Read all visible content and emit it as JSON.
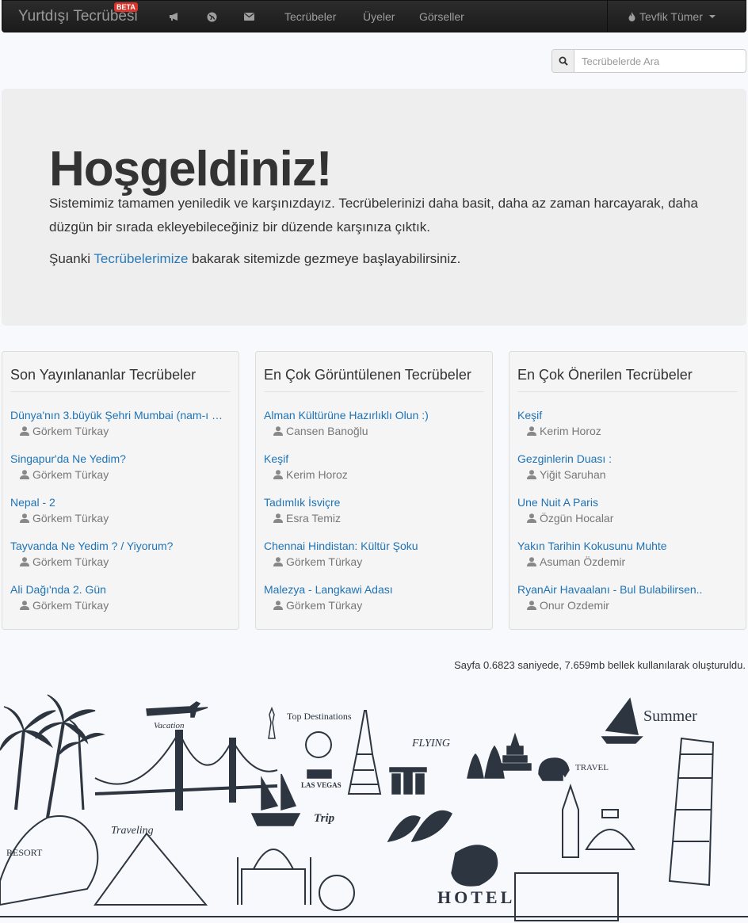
{
  "navbar": {
    "brand": "Yurtdışı Tecrübesi",
    "badge": "BETA",
    "icons": [
      "megaphone-icon",
      "globe-icon",
      "envelope-icon"
    ],
    "links": [
      "Tecrübeler",
      "Üyeler",
      "Görseller"
    ],
    "user": "Tevfik Tümer"
  },
  "search": {
    "placeholder": "Tecrübelerde Ara"
  },
  "hero": {
    "title": "Hoşgeldiniz!",
    "lead": "Sistemimiz tamamen yeniledik ve karşınızdayız. Tecrübelerinizi daha basit, daha az zaman harcayarak, daha düzgün bir sırada ekleyebileceğiniz bir düzende karşınıza çıktık.",
    "lead2_pre": "Şuanki ",
    "lead2_link": "Tecrübelerimize",
    "lead2_post": " bakarak sitemizde gezmeye başlayabilirsiniz."
  },
  "panels": [
    {
      "title": "Son Yayınlananlar Tecrübeler",
      "items": [
        {
          "title": "Dünya'nın 3.büyük Şehri Mumbai (nam-ı …",
          "author": "Görkem Türkay"
        },
        {
          "title": "Singapur'da Ne Yedim?",
          "author": "Görkem Türkay"
        },
        {
          "title": "Nepal - 2",
          "author": "Görkem Türkay"
        },
        {
          "title": "Tayvanda Ne Yedim ? / Yiyorum?",
          "author": "Görkem Türkay"
        },
        {
          "title": "Ali Dağı'nda 2. Gün",
          "author": "Görkem Türkay"
        }
      ]
    },
    {
      "title": "En Çok Görüntülenen Tecrübeler",
      "items": [
        {
          "title": "Alman Kültürüne Hazırlıklı Olun :)",
          "author": "Cansen Banoğlu"
        },
        {
          "title": "Keşif",
          "author": "Kerim Horoz"
        },
        {
          "title": "Tadımlık İsviçre",
          "author": "Esra Temiz"
        },
        {
          "title": "Chennai Hindistan: Kültür Şoku",
          "author": "Görkem Türkay"
        },
        {
          "title": "Malezya - Langkawi Adası",
          "author": "Görkem Türkay"
        }
      ]
    },
    {
      "title": "En Çok Önerilen Tecrübeler",
      "items": [
        {
          "title": "Keşif",
          "author": "Kerim Horoz"
        },
        {
          "title": "Gezginlerin Duası :",
          "author": "Yiğit Saruhan"
        },
        {
          "title": "Une Nuit A Paris",
          "author": "Özgün Hocalar"
        },
        {
          "title": "Yakın Tarihin Kokusunu Muhte",
          "author": "Asuman Özdemir"
        },
        {
          "title": "RyanAir Havaalanı - Bul Bulabilirsen..",
          "author": "Onur Ozdemir"
        }
      ]
    }
  ],
  "footer": "Sayfa 0.6823 saniyede, 7.659mb bellek kullanılarak oluşturuldu.",
  "illustration": {
    "labels": [
      "Vacation",
      "Top Destinations",
      "FLYING",
      "Summer",
      "TRAVEL",
      "LAS VEGAS",
      "Trip",
      "Traveling",
      "RESORT",
      "HOTEL"
    ]
  }
}
